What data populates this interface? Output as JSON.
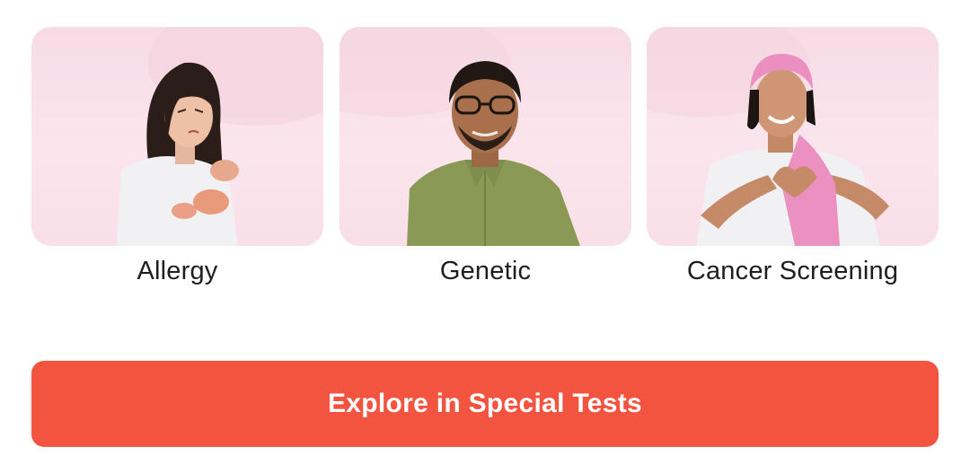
{
  "categories": [
    {
      "label": "Allergy",
      "image": "woman-scratching-arm-photo"
    },
    {
      "label": "Genetic",
      "image": "man-with-glasses-photo"
    },
    {
      "label": "Cancer Screening",
      "image": "woman-pink-headscarf-heart-hands-photo"
    }
  ],
  "cta": {
    "label": "Explore in Special Tests"
  },
  "colors": {
    "accent": "#f25440",
    "tile_bg": "#f7dbe6",
    "text": "#1e1e1e"
  }
}
